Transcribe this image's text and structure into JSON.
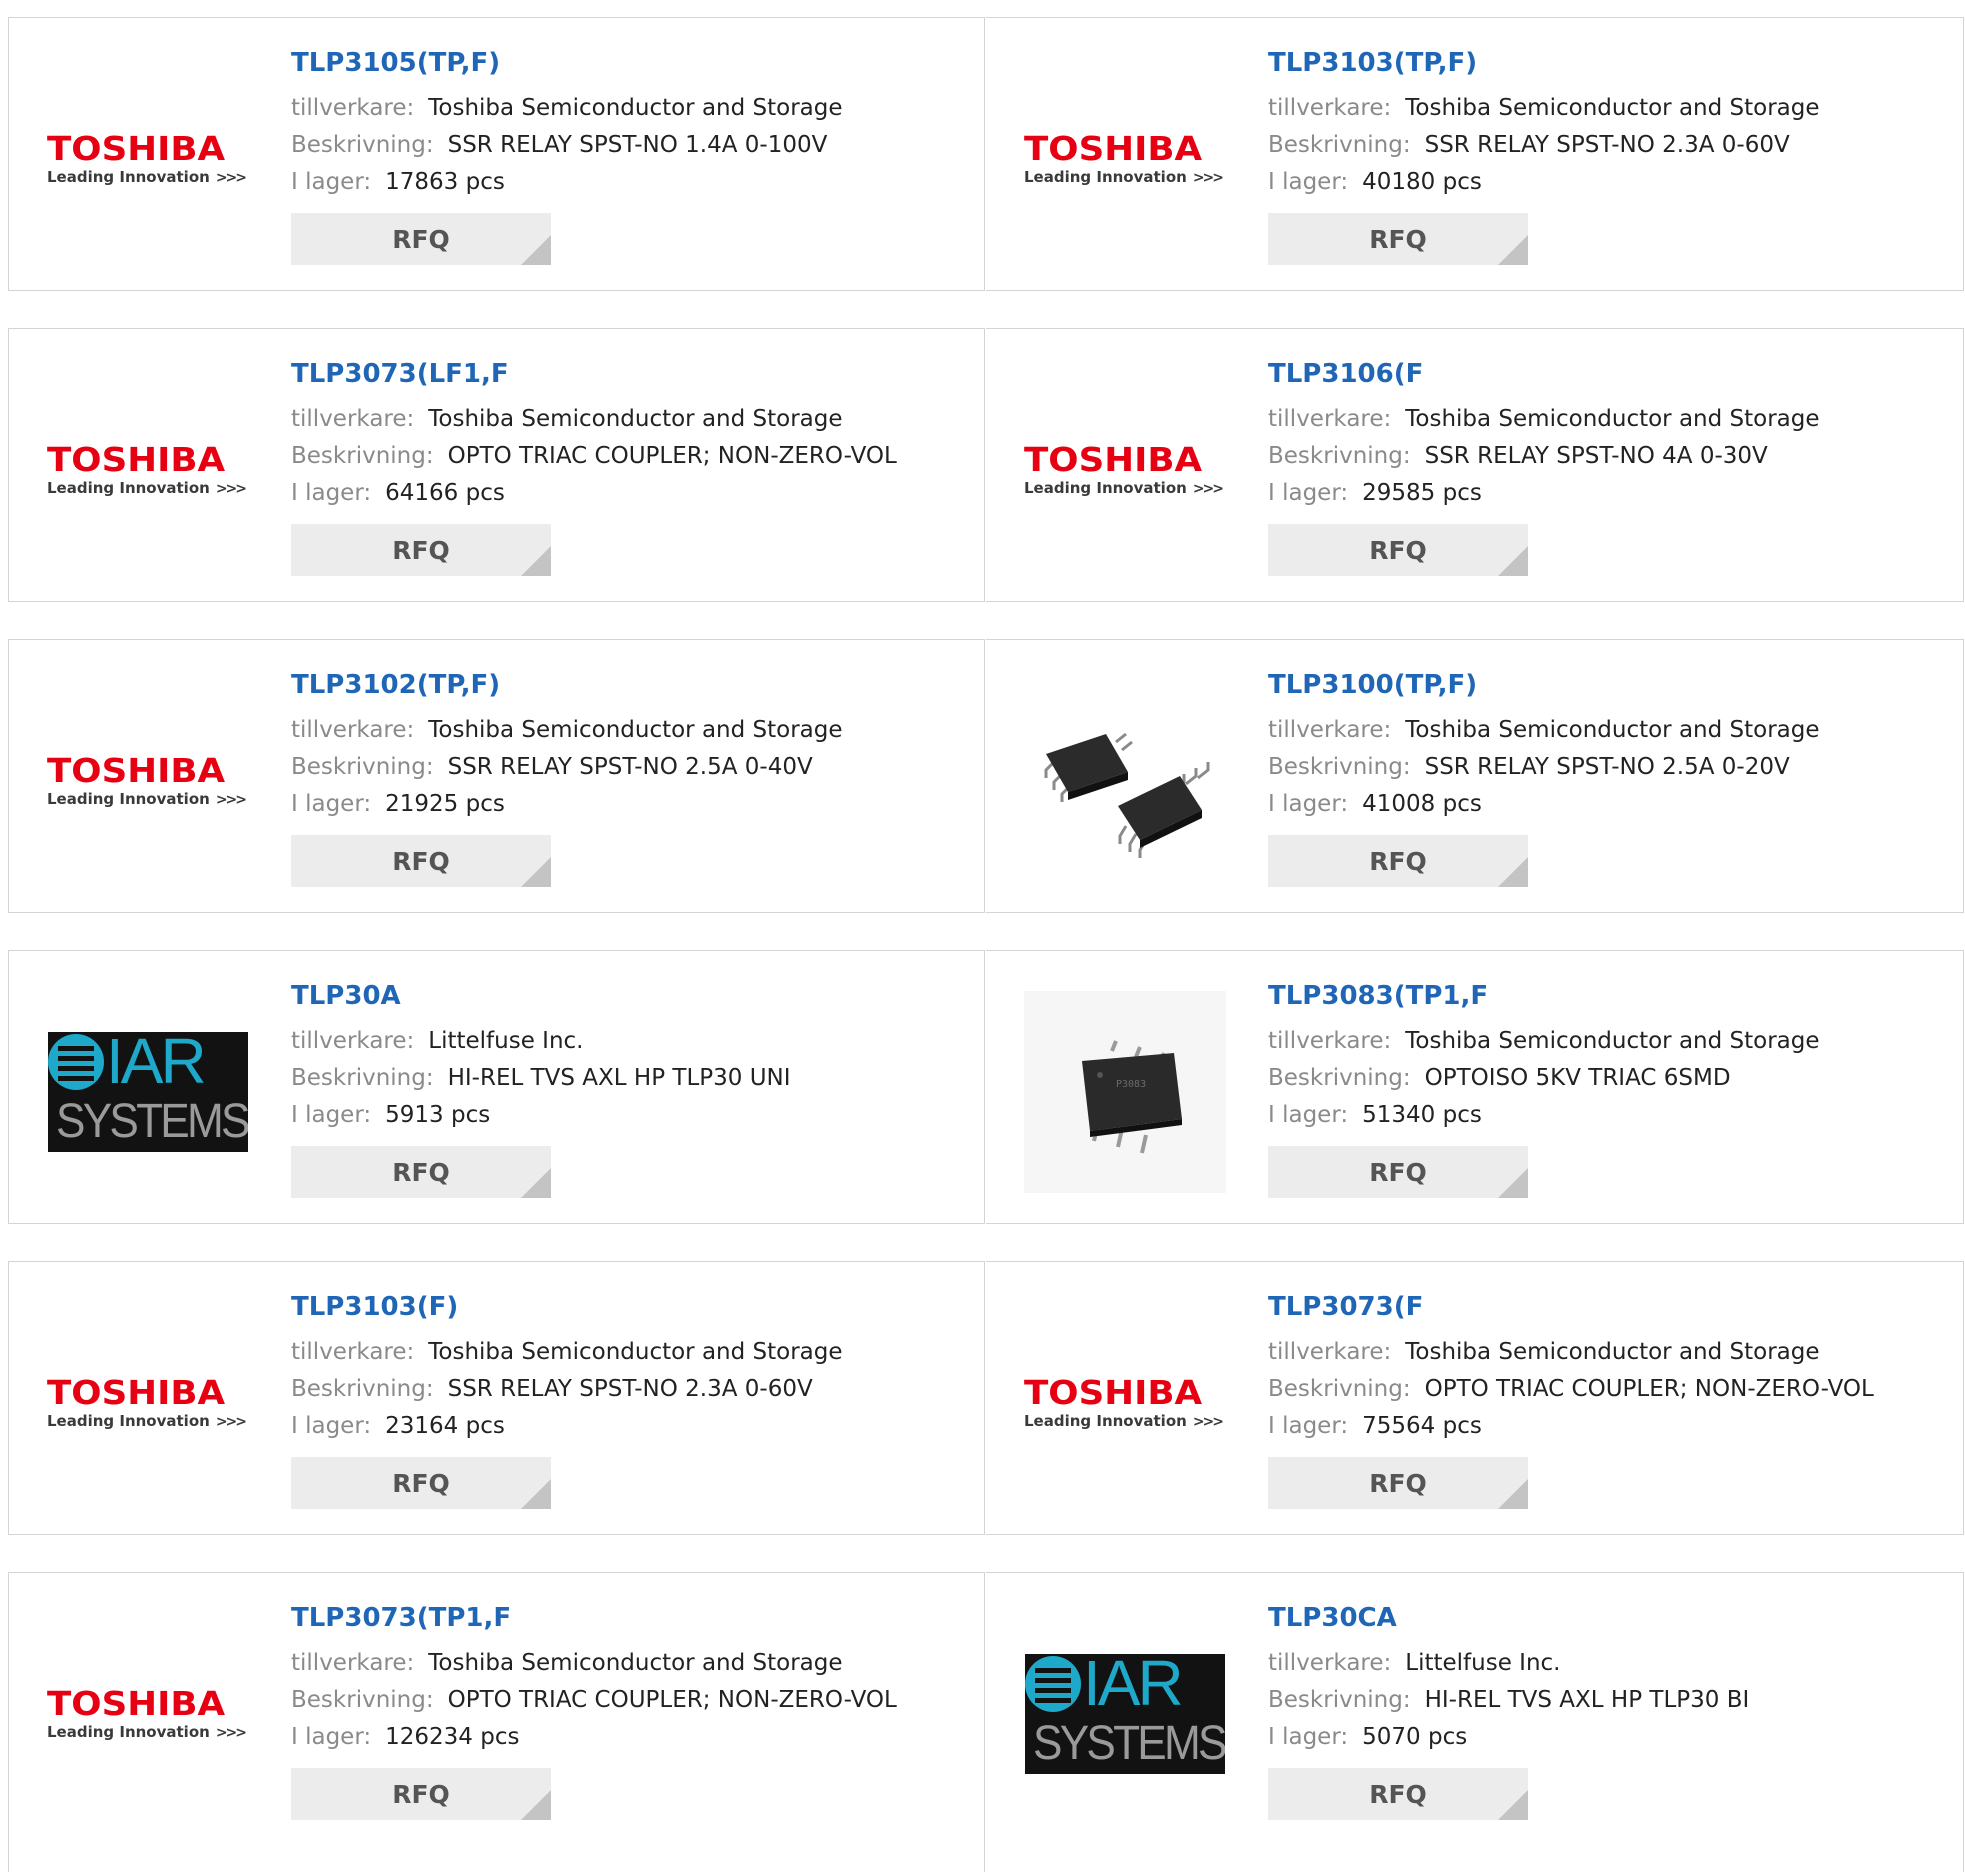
{
  "labels": {
    "manufacturer": "tillverkare:",
    "description": "Beskrivning:",
    "stock": "I lager:",
    "rfq": "RFQ"
  },
  "products": [
    {
      "name": "TLP3105(TP,F)",
      "manufacturer": "Toshiba Semiconductor and Storage",
      "description": "SSR RELAY SPST-NO 1.4A 0-100V",
      "stock": "17863 pcs",
      "logo": "toshiba"
    },
    {
      "name": "TLP3103(TP,F)",
      "manufacturer": "Toshiba Semiconductor and Storage",
      "description": "SSR RELAY SPST-NO 2.3A 0-60V",
      "stock": "40180 pcs",
      "logo": "toshiba"
    },
    {
      "name": "TLP3073(LF1,F",
      "manufacturer": "Toshiba Semiconductor and Storage",
      "description": "OPTO TRIAC COUPLER; NON-ZERO-VOL",
      "stock": "64166 pcs",
      "logo": "toshiba"
    },
    {
      "name": "TLP3106(F",
      "manufacturer": "Toshiba Semiconductor and Storage",
      "description": "SSR RELAY SPST-NO 4A 0-30V",
      "stock": "29585 pcs",
      "logo": "toshiba"
    },
    {
      "name": "TLP3102(TP,F)",
      "manufacturer": "Toshiba Semiconductor and Storage",
      "description": "SSR RELAY SPST-NO 2.5A 0-40V",
      "stock": "21925 pcs",
      "logo": "toshiba"
    },
    {
      "name": "TLP3100(TP,F)",
      "manufacturer": "Toshiba Semiconductor and Storage",
      "description": "SSR RELAY SPST-NO 2.5A 0-20V",
      "stock": "41008 pcs",
      "logo": "two-chips"
    },
    {
      "name": "TLP30A",
      "manufacturer": "Littelfuse Inc.",
      "description": "HI-REL TVS AXL HP TLP30 UNI",
      "stock": "5913 pcs",
      "logo": "iar-systems"
    },
    {
      "name": "TLP3083(TP1,F",
      "manufacturer": "Toshiba Semiconductor and Storage",
      "description": "OPTOISO 5KV TRIAC 6SMD",
      "stock": "51340 pcs",
      "logo": "single-chip"
    },
    {
      "name": "TLP3103(F)",
      "manufacturer": "Toshiba Semiconductor and Storage",
      "description": "SSR RELAY SPST-NO 2.3A 0-60V",
      "stock": "23164 pcs",
      "logo": "toshiba"
    },
    {
      "name": "TLP3073(F",
      "manufacturer": "Toshiba Semiconductor and Storage",
      "description": "OPTO TRIAC COUPLER; NON-ZERO-VOL",
      "stock": "75564 pcs",
      "logo": "toshiba"
    },
    {
      "name": "TLP3073(TP1,F",
      "manufacturer": "Toshiba Semiconductor and Storage",
      "description": "OPTO TRIAC COUPLER; NON-ZERO-VOL",
      "stock": "126234 pcs",
      "logo": "toshiba"
    },
    {
      "name": "TLP30CA",
      "manufacturer": "Littelfuse Inc.",
      "description": "HI-REL TVS AXL HP TLP30 BI",
      "stock": "5070 pcs",
      "logo": "iar-systems"
    }
  ],
  "logos": {
    "toshiba": {
      "word": "TOSHIBA",
      "tagline": "Leading Innovation",
      "chevrons": ">>>"
    },
    "iar": {
      "letters": "IAR",
      "sub": "SYSTEMS"
    }
  },
  "colors": {
    "link": "#1f66b7",
    "label": "#8a8a8a",
    "value": "#222222",
    "rfq_bg": "#ececec",
    "rfq_corner": "#c4c4c4",
    "border": "#d4d4d4",
    "toshiba_red": "#e60012",
    "iar_cyan": "#1ea8c9"
  }
}
